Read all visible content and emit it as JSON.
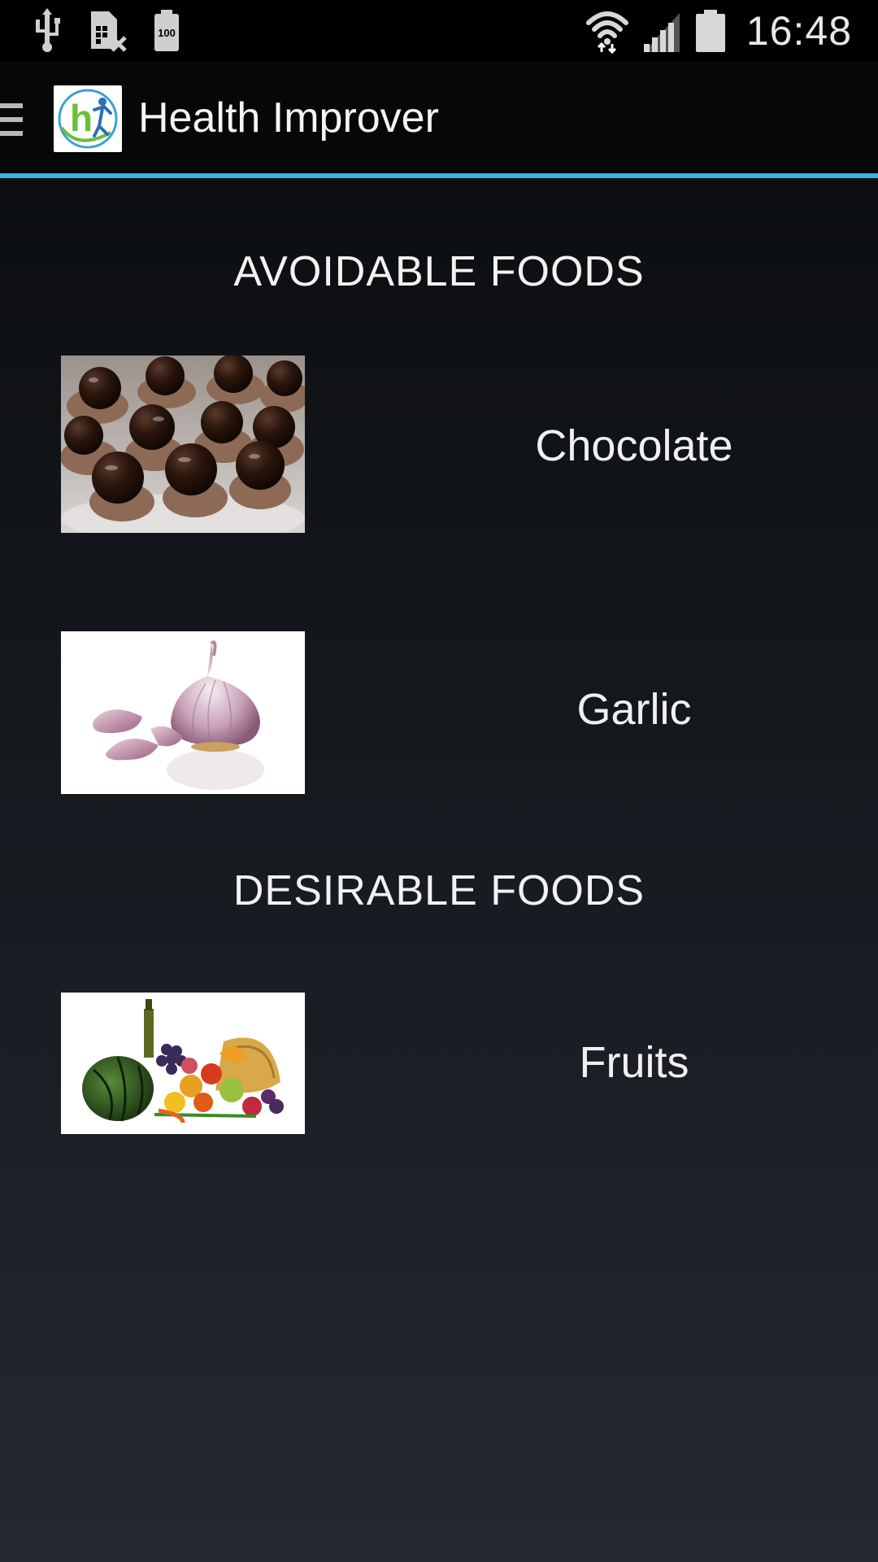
{
  "status_bar": {
    "time": "16:48",
    "battery_text": "100",
    "icons": [
      "usb-icon",
      "sim-missing-icon",
      "battery-full-small-icon",
      "wifi-icon",
      "signal-icon",
      "battery-icon"
    ]
  },
  "action_bar": {
    "title": "Health Improver",
    "logo_letter": "h",
    "accent_color": "#33b5e5"
  },
  "sections": [
    {
      "title": "AVOIDABLE FOODS",
      "items": [
        {
          "label": "Chocolate",
          "image": "chocolate-photo"
        },
        {
          "label": "Garlic",
          "image": "garlic-photo"
        }
      ]
    },
    {
      "title": "DESIRABLE FOODS",
      "items": [
        {
          "label": "Fruits",
          "image": "fruits-photo"
        }
      ]
    }
  ]
}
